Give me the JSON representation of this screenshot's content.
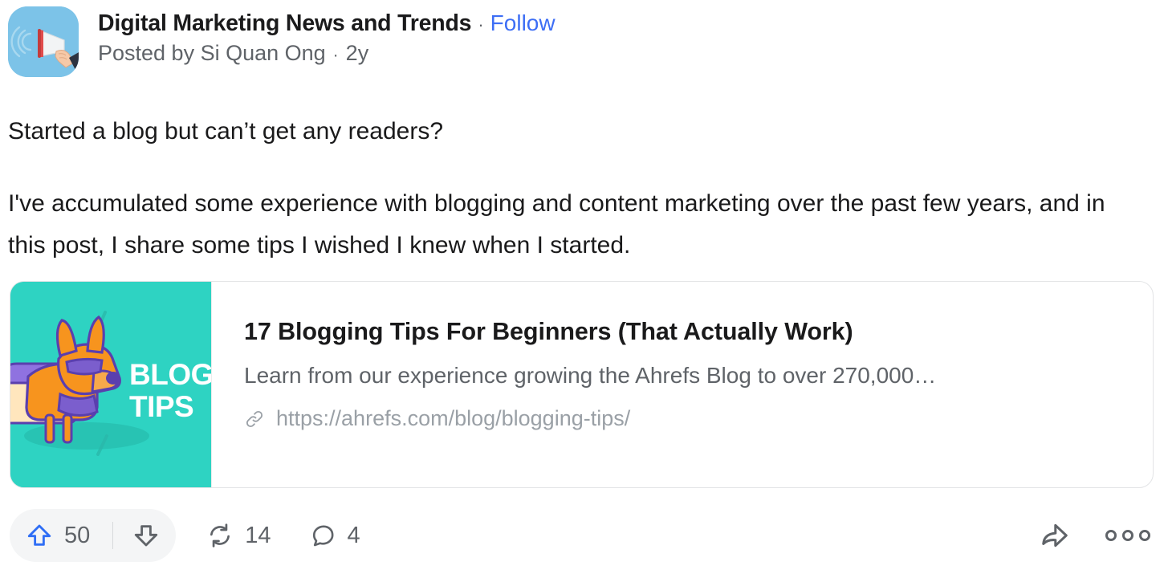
{
  "header": {
    "community_name": "Digital Marketing News and Trends",
    "separator": "·",
    "follow_label": "Follow",
    "posted_by": "Posted by Si Quan Ong",
    "age": "2y",
    "avatar_icon": "megaphone-icon"
  },
  "body": {
    "paragraph_1": "Started a blog but can’t get any readers?",
    "paragraph_2": "I've accumulated some experience with blogging and content marketing over the past few years, and in this post, I share some tips I wished I knew when I started."
  },
  "link_card": {
    "title": "17 Blogging Tips For Beginners (That Actually Work)",
    "description": "Learn from our experience growing the Ahrefs Blog to over 270,000…",
    "url": "https://ahrefs.com/blog/blogging-tips/",
    "link_icon": "link-chain-icon",
    "thumbnail": {
      "text_line_1": "BLOGG",
      "text_line_2": "TIPS",
      "background_color": "#2ed3c2",
      "dog_body_color": "#f7931e",
      "accent_color": "#7b5ecd"
    }
  },
  "actions": {
    "upvote_icon": "upvote-arrow-icon",
    "upvote_count": "50",
    "downvote_icon": "downvote-arrow-icon",
    "repost_icon": "repost-icon",
    "repost_count": "14",
    "comment_icon": "comment-bubble-icon",
    "comment_count": "4",
    "share_icon": "share-arrow-icon",
    "more_icon": "more-options-icon"
  },
  "colors": {
    "accent_blue": "#3d6ef5",
    "upvote_blue": "#2f6ef5",
    "muted_gray": "#5f6368",
    "pill_bg": "#f4f5f6",
    "card_border": "#e3e4e6"
  }
}
